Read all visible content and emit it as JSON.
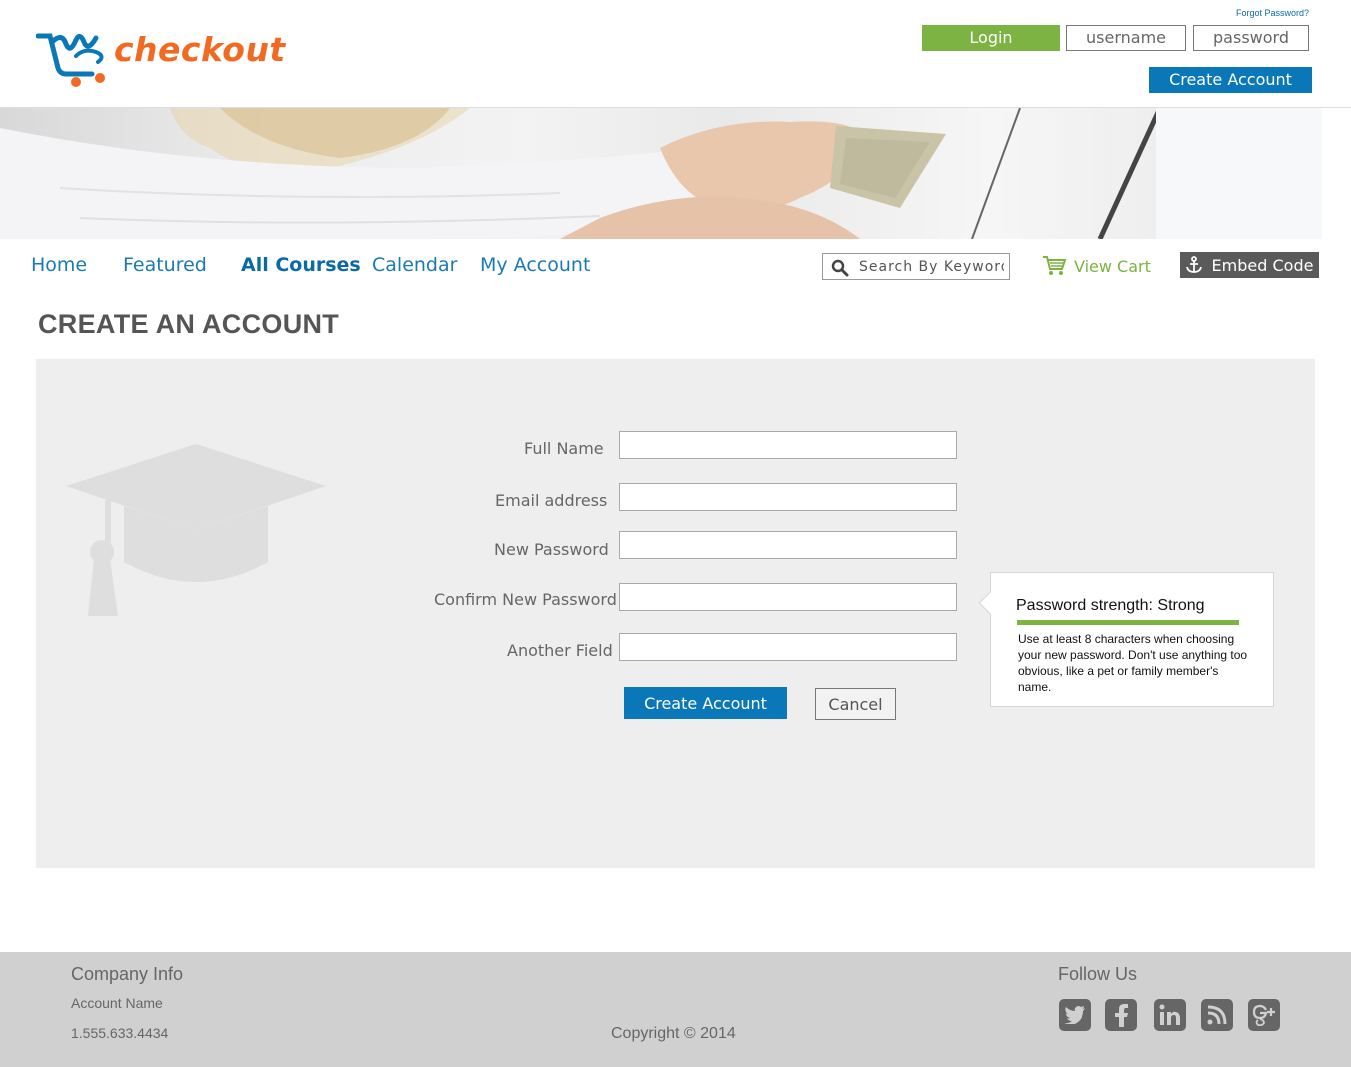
{
  "header": {
    "logo_text": "checkout",
    "forgot_password": "Forgot Password?",
    "login_label": "Login",
    "username_placeholder": "username",
    "password_placeholder": "password",
    "create_account_label": "Create  Account"
  },
  "nav": {
    "items": [
      {
        "label": "Home"
      },
      {
        "label": "Featured"
      },
      {
        "label": "All Courses",
        "active": true
      },
      {
        "label": "Calendar"
      },
      {
        "label": "My Account"
      }
    ],
    "search_placeholder": "Search By Keyword",
    "view_cart_label": "View Cart",
    "embed_code_label": "Embed Code"
  },
  "page": {
    "title": "CREATE AN ACCOUNT"
  },
  "form": {
    "fields": [
      {
        "label": "Full Name",
        "value": ""
      },
      {
        "label": "Email address",
        "value": ""
      },
      {
        "label": "New Password",
        "value": ""
      },
      {
        "label": "Confirm New Password",
        "value": ""
      },
      {
        "label": "Another Field",
        "value": ""
      }
    ],
    "submit_label": "Create  Account",
    "cancel_label": "Cancel"
  },
  "password_tip": {
    "title": "Password strength: Strong",
    "strength": "Strong",
    "text": "Use at least 8 characters when choosing your new password.  Don't use anything too obvious, like a pet or family member's name."
  },
  "footer": {
    "company_title": "Company Info",
    "account_name": "Account Name",
    "phone": "1.555.633.4434",
    "copyright": "Copyright © 2014",
    "follow_title": "Follow Us",
    "social_icons": [
      "twitter-icon",
      "facebook-icon",
      "linkedin-icon",
      "rss-icon",
      "google-plus-icon"
    ]
  },
  "colors": {
    "brand_orange": "#f26a21",
    "brand_blue": "#0a78b8",
    "accent_green": "#7cb342",
    "nav_blue": "#1a7ab5",
    "panel_bg": "#eeeeee",
    "footer_bg": "#d0d0d0"
  }
}
